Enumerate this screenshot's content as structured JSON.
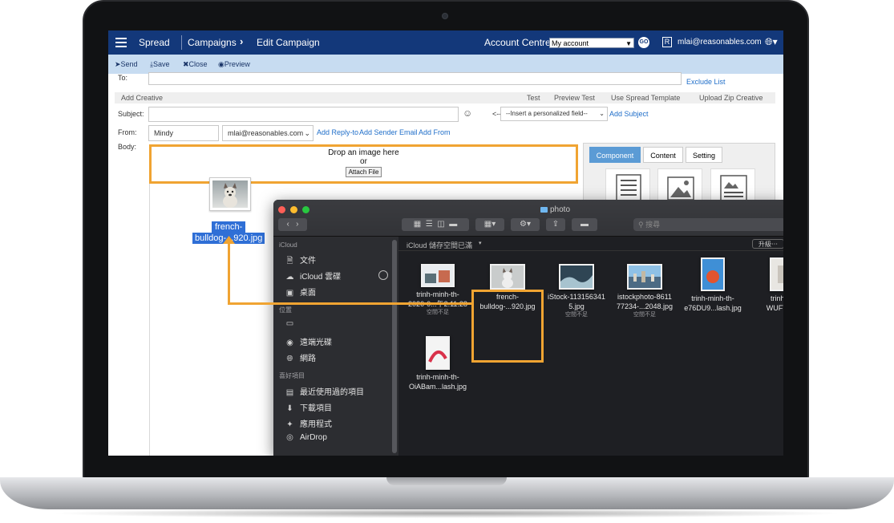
{
  "app": {
    "brand": "Spread",
    "breadcrumb": [
      "Campaigns",
      "Edit Campaign"
    ],
    "account_label": "Account Centre :",
    "account_select": "My account",
    "go_label": "GO",
    "user_badge": "R",
    "user_email": "mlai@reasonables.com"
  },
  "toolbar": {
    "send": "Send",
    "save": "Save",
    "close": "Close",
    "preview": "Preview"
  },
  "form": {
    "to_label": "To:",
    "exclude_list": "Exclude List",
    "add_creative": "Add Creative",
    "actions": [
      "Test",
      "Preview Test",
      "Use Spread Template",
      "Upload Zip Creative"
    ],
    "subject_label": "Subject:",
    "insert_arrow": "<--",
    "personalized_select": "--Insert a personalized field--",
    "add_subject": "Add Subject",
    "from_label": "From:",
    "from_name": "Mindy",
    "from_email": "mlai@reasonables.com",
    "add_reply_to": "Add Reply-to",
    "add_sender_email": "Add Sender Email",
    "add_from": "Add From",
    "body_label": "Body:",
    "drop_text": "Drop an image here",
    "or_text": "or",
    "attach_file": "Attach File"
  },
  "panel_tabs": [
    "Component",
    "Content",
    "Setting"
  ],
  "drag": {
    "label_line1": "french-",
    "label_line2": "bulldog-...920.jpg"
  },
  "finder": {
    "title": "photo",
    "search_placeholder": "搜尋",
    "icloud_status": "iCloud 儲存空間已滿",
    "upgrade": "升級⋯",
    "sidebar": {
      "icloud_head": "iCloud",
      "icloud_items": [
        "文件",
        "iCloud 雲碟",
        "桌面"
      ],
      "locations_head": "位置",
      "locations_items": [
        "",
        "遠端光碟",
        "網路"
      ],
      "favorites_head": "喜好項目",
      "favorites_items": [
        "最近使用過的項目",
        "下載項目",
        "應用程式",
        "AirDrop"
      ]
    },
    "files": [
      {
        "name1": "trinh-minh-th-",
        "name2": "2020-0...午2.11.28",
        "status": "空間不足"
      },
      {
        "name1": "french-",
        "name2": "bulldog-...920.jpg",
        "status": ""
      },
      {
        "name1": "iStock-113156341",
        "name2": "5.jpg",
        "status": "空間不足"
      },
      {
        "name1": "istockphoto-8611",
        "name2": "77234-...2048.jpg",
        "status": "空間不足"
      },
      {
        "name1": "trinh-minh-th-",
        "name2": "e76DU9...lash.jpg",
        "status": ""
      },
      {
        "name1": "trinh-m",
        "name2": "WUFTh...",
        "status": ""
      },
      {
        "name1": "trinh-minh-th-",
        "name2": "OiABam...lash.jpg",
        "status": ""
      }
    ]
  },
  "colors": {
    "nav": "#13387a",
    "toolbar": "#c7dcf1",
    "highlight": "#f0a432",
    "link": "#1f6ec9"
  }
}
